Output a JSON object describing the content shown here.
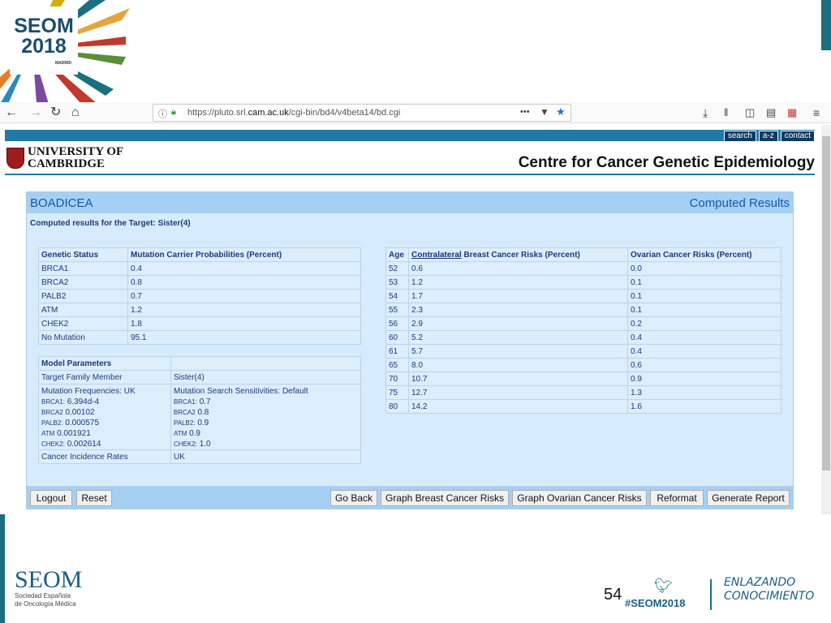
{
  "slide": {
    "logo_line1": "SEOM",
    "logo_line2": "2018",
    "logo_city": "MADRID",
    "footer_brand": "SEOM",
    "footer_sub1": "Sociedad Española",
    "footer_sub2": "de Oncología Médica",
    "page_number": "54",
    "hashtag": "#SEOM2018",
    "slogan_line1": "ENLAZANDO",
    "slogan_line2": "CONOCIMIENTO"
  },
  "browser": {
    "url_prefix": "https://pluto.srl.",
    "url_domain": "cam.ac.uk",
    "url_path": "/cgi-bin/bd4/v4beta14/bd.cgi",
    "page_actions_label": "•••"
  },
  "site": {
    "quick_links": [
      "search",
      "a-z",
      "contact"
    ],
    "university_line1": "UNIVERSITY OF",
    "university_line2": "CAMBRIDGE",
    "centre_title": "Centre for Cancer Genetic Epidemiology"
  },
  "panel": {
    "title": "BOADICEA",
    "right_title": "Computed Results",
    "target_line": "Computed results for the Target: Sister(4)"
  },
  "carrier_table": {
    "headers": [
      "Genetic Status",
      "Mutation Carrier Probabilities (Percent)"
    ],
    "rows": [
      [
        "BRCA1",
        "0.4"
      ],
      [
        "BRCA2",
        "0.8"
      ],
      [
        "PALB2",
        "0.7"
      ],
      [
        "ATM",
        "1.2"
      ],
      [
        "CHEK2",
        "1.8"
      ],
      [
        "No Mutation",
        "95.1"
      ]
    ]
  },
  "model_table": {
    "header": "Model Parameters",
    "target_label": "Target Family Member",
    "target_value": "Sister(4)",
    "freq_title": "Mutation Frequencies: UK",
    "freqs": [
      [
        "BRCA1:",
        "6.394d-4"
      ],
      [
        "BRCA2",
        "0.00102"
      ],
      [
        "PALB2:",
        "0.000575"
      ],
      [
        "ATM",
        "0.001921"
      ],
      [
        "CHEK2:",
        "0.002614"
      ]
    ],
    "sens_title": "Mutation Search Sensitivities: Default",
    "sens": [
      [
        "BRCA1:",
        "0.7"
      ],
      [
        "BRCA2",
        "0.8"
      ],
      [
        "PALB2:",
        "0.9"
      ],
      [
        "ATM",
        "0.9"
      ],
      [
        "CHEK2:",
        "1.0"
      ]
    ],
    "incidence_label": "Cancer Incidence Rates",
    "incidence_value": "UK"
  },
  "risk_table": {
    "h_age": "Age",
    "h_contra": "Contralateral",
    "h_breast_rest": " Breast Cancer Risks (Percent)",
    "h_ovarian": "Ovarian Cancer Risks (Percent)",
    "rows": [
      [
        "52",
        "0.6",
        "0.0"
      ],
      [
        "53",
        "1.2",
        "0.1"
      ],
      [
        "54",
        "1.7",
        "0.1"
      ],
      [
        "55",
        "2.3",
        "0.1"
      ],
      [
        "56",
        "2.9",
        "0.2"
      ],
      [
        "60",
        "5.2",
        "0.4"
      ],
      [
        "61",
        "5.7",
        "0.4"
      ],
      [
        "65",
        "8.0",
        "0.6"
      ],
      [
        "70",
        "10.7",
        "0.9"
      ],
      [
        "75",
        "12.7",
        "1.3"
      ],
      [
        "80",
        "14.2",
        "1.6"
      ]
    ]
  },
  "buttons": {
    "logout": "Logout",
    "reset": "Reset",
    "go_back": "Go Back",
    "graph_breast": "Graph Breast Cancer Risks",
    "graph_ovarian": "Graph Ovarian Cancer Risks",
    "reformat": "Reformat",
    "generate_report": "Generate Report"
  }
}
